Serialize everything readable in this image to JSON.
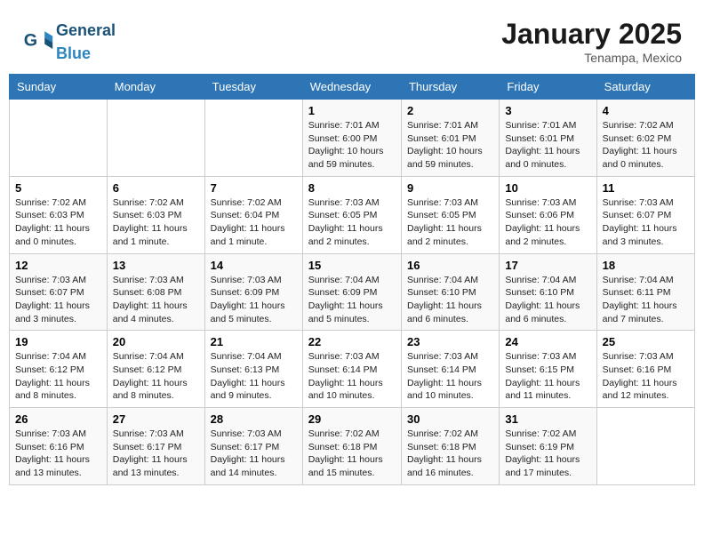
{
  "header": {
    "logo_general": "General",
    "logo_blue": "Blue",
    "month": "January 2025",
    "location": "Tenampa, Mexico"
  },
  "days_of_week": [
    "Sunday",
    "Monday",
    "Tuesday",
    "Wednesday",
    "Thursday",
    "Friday",
    "Saturday"
  ],
  "weeks": [
    [
      {
        "day": "",
        "info": ""
      },
      {
        "day": "",
        "info": ""
      },
      {
        "day": "",
        "info": ""
      },
      {
        "day": "1",
        "info": "Sunrise: 7:01 AM\nSunset: 6:00 PM\nDaylight: 10 hours and 59 minutes."
      },
      {
        "day": "2",
        "info": "Sunrise: 7:01 AM\nSunset: 6:01 PM\nDaylight: 10 hours and 59 minutes."
      },
      {
        "day": "3",
        "info": "Sunrise: 7:01 AM\nSunset: 6:01 PM\nDaylight: 11 hours and 0 minutes."
      },
      {
        "day": "4",
        "info": "Sunrise: 7:02 AM\nSunset: 6:02 PM\nDaylight: 11 hours and 0 minutes."
      }
    ],
    [
      {
        "day": "5",
        "info": "Sunrise: 7:02 AM\nSunset: 6:03 PM\nDaylight: 11 hours and 0 minutes."
      },
      {
        "day": "6",
        "info": "Sunrise: 7:02 AM\nSunset: 6:03 PM\nDaylight: 11 hours and 1 minute."
      },
      {
        "day": "7",
        "info": "Sunrise: 7:02 AM\nSunset: 6:04 PM\nDaylight: 11 hours and 1 minute."
      },
      {
        "day": "8",
        "info": "Sunrise: 7:03 AM\nSunset: 6:05 PM\nDaylight: 11 hours and 2 minutes."
      },
      {
        "day": "9",
        "info": "Sunrise: 7:03 AM\nSunset: 6:05 PM\nDaylight: 11 hours and 2 minutes."
      },
      {
        "day": "10",
        "info": "Sunrise: 7:03 AM\nSunset: 6:06 PM\nDaylight: 11 hours and 2 minutes."
      },
      {
        "day": "11",
        "info": "Sunrise: 7:03 AM\nSunset: 6:07 PM\nDaylight: 11 hours and 3 minutes."
      }
    ],
    [
      {
        "day": "12",
        "info": "Sunrise: 7:03 AM\nSunset: 6:07 PM\nDaylight: 11 hours and 3 minutes."
      },
      {
        "day": "13",
        "info": "Sunrise: 7:03 AM\nSunset: 6:08 PM\nDaylight: 11 hours and 4 minutes."
      },
      {
        "day": "14",
        "info": "Sunrise: 7:03 AM\nSunset: 6:09 PM\nDaylight: 11 hours and 5 minutes."
      },
      {
        "day": "15",
        "info": "Sunrise: 7:04 AM\nSunset: 6:09 PM\nDaylight: 11 hours and 5 minutes."
      },
      {
        "day": "16",
        "info": "Sunrise: 7:04 AM\nSunset: 6:10 PM\nDaylight: 11 hours and 6 minutes."
      },
      {
        "day": "17",
        "info": "Sunrise: 7:04 AM\nSunset: 6:10 PM\nDaylight: 11 hours and 6 minutes."
      },
      {
        "day": "18",
        "info": "Sunrise: 7:04 AM\nSunset: 6:11 PM\nDaylight: 11 hours and 7 minutes."
      }
    ],
    [
      {
        "day": "19",
        "info": "Sunrise: 7:04 AM\nSunset: 6:12 PM\nDaylight: 11 hours and 8 minutes."
      },
      {
        "day": "20",
        "info": "Sunrise: 7:04 AM\nSunset: 6:12 PM\nDaylight: 11 hours and 8 minutes."
      },
      {
        "day": "21",
        "info": "Sunrise: 7:04 AM\nSunset: 6:13 PM\nDaylight: 11 hours and 9 minutes."
      },
      {
        "day": "22",
        "info": "Sunrise: 7:03 AM\nSunset: 6:14 PM\nDaylight: 11 hours and 10 minutes."
      },
      {
        "day": "23",
        "info": "Sunrise: 7:03 AM\nSunset: 6:14 PM\nDaylight: 11 hours and 10 minutes."
      },
      {
        "day": "24",
        "info": "Sunrise: 7:03 AM\nSunset: 6:15 PM\nDaylight: 11 hours and 11 minutes."
      },
      {
        "day": "25",
        "info": "Sunrise: 7:03 AM\nSunset: 6:16 PM\nDaylight: 11 hours and 12 minutes."
      }
    ],
    [
      {
        "day": "26",
        "info": "Sunrise: 7:03 AM\nSunset: 6:16 PM\nDaylight: 11 hours and 13 minutes."
      },
      {
        "day": "27",
        "info": "Sunrise: 7:03 AM\nSunset: 6:17 PM\nDaylight: 11 hours and 13 minutes."
      },
      {
        "day": "28",
        "info": "Sunrise: 7:03 AM\nSunset: 6:17 PM\nDaylight: 11 hours and 14 minutes."
      },
      {
        "day": "29",
        "info": "Sunrise: 7:02 AM\nSunset: 6:18 PM\nDaylight: 11 hours and 15 minutes."
      },
      {
        "day": "30",
        "info": "Sunrise: 7:02 AM\nSunset: 6:18 PM\nDaylight: 11 hours and 16 minutes."
      },
      {
        "day": "31",
        "info": "Sunrise: 7:02 AM\nSunset: 6:19 PM\nDaylight: 11 hours and 17 minutes."
      },
      {
        "day": "",
        "info": ""
      }
    ]
  ]
}
